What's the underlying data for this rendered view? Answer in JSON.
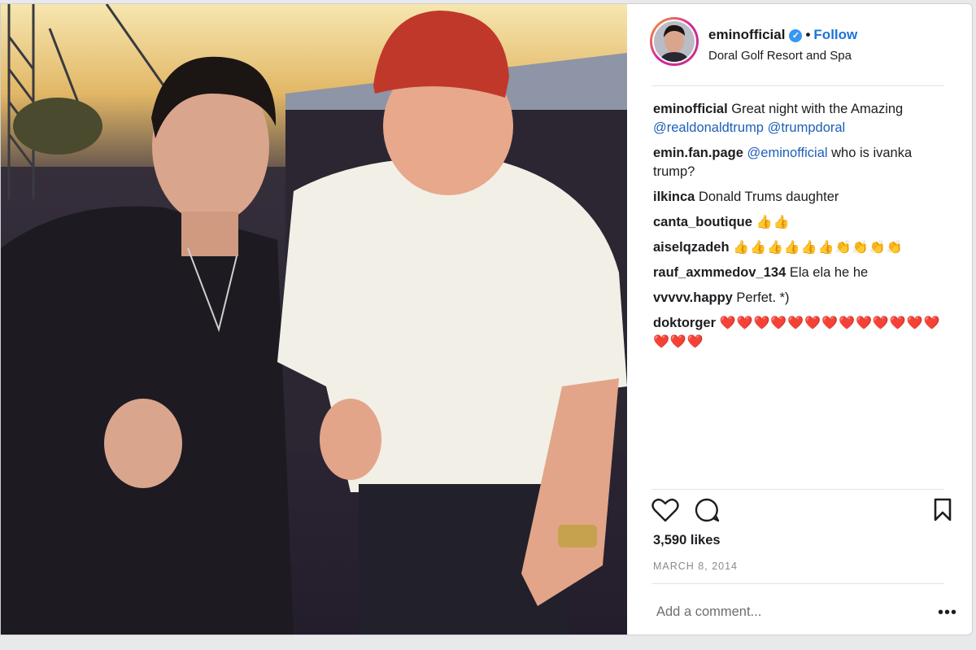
{
  "post": {
    "username": "eminofficial",
    "follow_label": "Follow",
    "dot": "•",
    "location": "Doral Golf Resort and Spa",
    "verified_glyph": "✓"
  },
  "comments": [
    {
      "user": "eminofficial",
      "parts": [
        {
          "t": "text",
          "v": " Great night with the Amazing "
        },
        {
          "t": "mention",
          "v": "@realdonaldtrump"
        },
        {
          "t": "text",
          "v": " "
        },
        {
          "t": "mention",
          "v": "@trumpdoral"
        }
      ]
    },
    {
      "user": "emin.fan.page",
      "parts": [
        {
          "t": "text",
          "v": " "
        },
        {
          "t": "mention",
          "v": "@eminofficial"
        },
        {
          "t": "text",
          "v": " who is ivanka trump?"
        }
      ]
    },
    {
      "user": "ilkinca",
      "parts": [
        {
          "t": "text",
          "v": " Donald Trums daughter"
        }
      ]
    },
    {
      "user": "canta_boutique",
      "parts": [
        {
          "t": "text",
          "v": " "
        },
        {
          "t": "thumb",
          "v": "👍👍"
        }
      ]
    },
    {
      "user": "aiselqzadeh",
      "parts": [
        {
          "t": "text",
          "v": " "
        },
        {
          "t": "thumb",
          "v": "👍👍👍👍👍👍"
        },
        {
          "t": "clap",
          "v": "👏👏👏👏"
        }
      ]
    },
    {
      "user": "rauf_axmmedov_134",
      "parts": [
        {
          "t": "text",
          "v": " Ela ela he he"
        }
      ]
    },
    {
      "user": "vvvvv.happy",
      "parts": [
        {
          "t": "text",
          "v": " Perfet. *)"
        }
      ]
    },
    {
      "user": "doktorger",
      "parts": [
        {
          "t": "text",
          "v": " "
        },
        {
          "t": "heart",
          "v": "❤️❤️❤️❤️❤️❤️❤️❤️❤️❤️❤️❤️❤️❤️❤️❤️"
        }
      ]
    }
  ],
  "likes": "3,590 likes",
  "date": "MARCH 8, 2014",
  "add_comment_placeholder": "Add a comment...",
  "more_glyph": "•••",
  "icons": {
    "like": "heart-outline-icon",
    "comment": "speech-bubble-icon",
    "save": "bookmark-icon"
  },
  "colors": {
    "link": "#1e5fb8",
    "follow": "#1e73d8",
    "heart": "#e0232e"
  }
}
